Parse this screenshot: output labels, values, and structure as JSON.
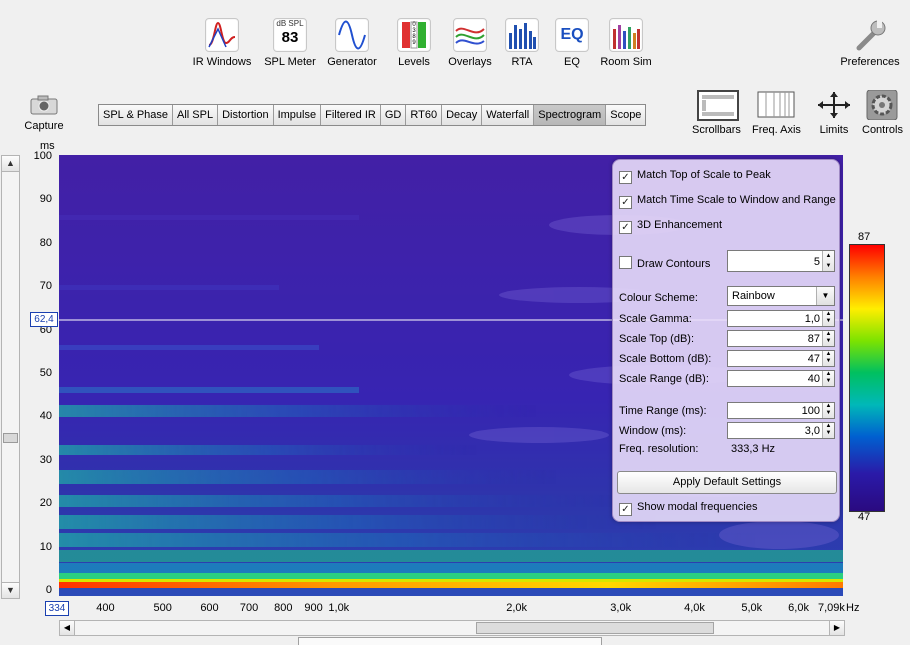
{
  "toolbar": [
    {
      "key": "ir_windows",
      "label": "IR Windows",
      "icon": "ir-windows-icon"
    },
    {
      "key": "spl_meter",
      "label": "SPL Meter",
      "icon": "spl-meter-icon",
      "caption": "dB SPL",
      "value": "83"
    },
    {
      "key": "generator",
      "label": "Generator",
      "icon": "generator-icon"
    },
    {
      "key": "levels",
      "label": "Levels",
      "icon": "levels-icon",
      "digits": "0389"
    },
    {
      "key": "overlays",
      "label": "Overlays",
      "icon": "overlays-icon"
    },
    {
      "key": "rta",
      "label": "RTA",
      "icon": "rta-icon"
    },
    {
      "key": "eq",
      "label": "EQ",
      "icon": "eq-icon",
      "glyph": "EQ"
    },
    {
      "key": "room_sim",
      "label": "Room Sim",
      "icon": "room-sim-icon"
    }
  ],
  "preferences_label": "Preferences",
  "capture_label": "Capture",
  "tabs": [
    "SPL & Phase",
    "All SPL",
    "Distortion",
    "Impulse",
    "Filtered IR",
    "GD",
    "RT60",
    "Decay",
    "Waterfall",
    "Spectrogram",
    "Scope"
  ],
  "active_tab": "Spectrogram",
  "right_tools": {
    "scrollbars": "Scrollbars",
    "freq_axis": "Freq. Axis",
    "limits": "Limits",
    "controls": "Controls"
  },
  "y_axis": {
    "unit": "ms",
    "ticks": [
      "100",
      "90",
      "80",
      "70",
      "60",
      "50",
      "40",
      "30",
      "20",
      "10",
      "0"
    ],
    "cursor": "62,4"
  },
  "x_axis": {
    "start": "334",
    "ticks": [
      "400",
      "500",
      "600",
      "700",
      "800",
      "900",
      "1,0k",
      "2,0k",
      "3,0k",
      "4,0k",
      "5,0k",
      "6,0k",
      "7,09k"
    ],
    "unit": "Hz"
  },
  "panel": {
    "match_top": "Match Top of Scale to Peak",
    "match_time": "Match Time Scale to Window and Range",
    "enh3d": "3D Enhancement",
    "draw_contours": "Draw Contours",
    "contours_value": "5",
    "colour_scheme_label": "Colour Scheme:",
    "colour_scheme_value": "Rainbow",
    "gamma_label": "Scale Gamma:",
    "gamma_value": "1,0",
    "top_label": "Scale Top (dB):",
    "top_value": "87",
    "bottom_label": "Scale Bottom (dB):",
    "bottom_value": "47",
    "range_label": "Scale Range (dB):",
    "range_value": "40",
    "time_range_label": "Time Range (ms):",
    "time_range_value": "100",
    "window_label": "Window (ms):",
    "window_value": "3,0",
    "freq_res_label": "Freq. resolution:",
    "freq_res_value": "333,3 Hz",
    "apply_default": "Apply Default Settings",
    "show_modal": "Show modal frequencies",
    "checked": {
      "match_top": true,
      "match_time": true,
      "enh3d": true,
      "draw_contours": false,
      "show_modal": true
    }
  },
  "colour_scale": {
    "top": "87",
    "bottom": "47"
  }
}
